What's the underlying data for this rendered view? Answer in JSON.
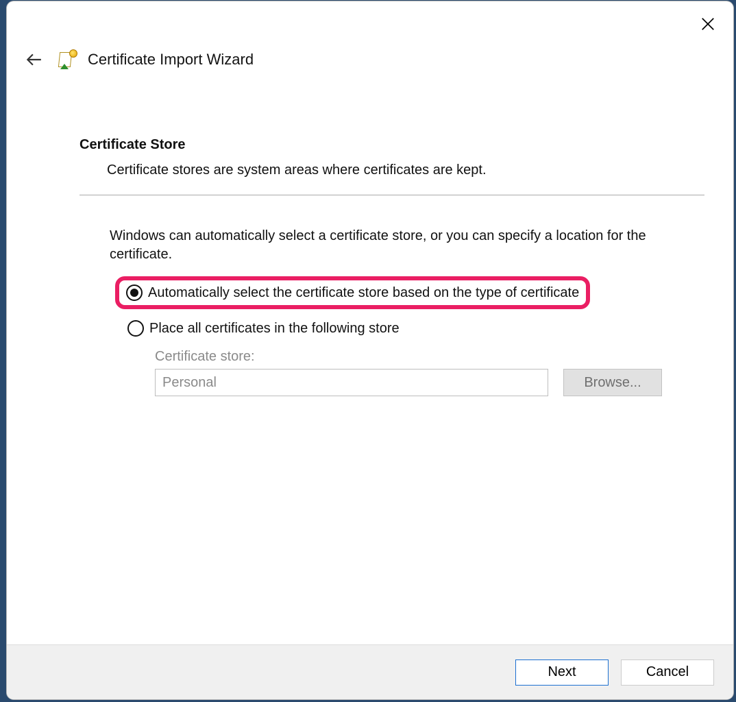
{
  "wizard": {
    "title": "Certificate Import Wizard"
  },
  "section": {
    "heading": "Certificate Store",
    "description": "Certificate stores are system areas where certificates are kept.",
    "instruction": "Windows can automatically select a certificate store, or you can specify a location for the certificate."
  },
  "options": {
    "auto_label": "Automatically select the certificate store based on the type of certificate",
    "place_label": "Place all certificates in the following store",
    "selected": "auto"
  },
  "store": {
    "label": "Certificate store:",
    "value": "Personal",
    "browse_label": "Browse..."
  },
  "footer": {
    "next_label": "Next",
    "cancel_label": "Cancel"
  },
  "colors": {
    "highlight": "#ea1e63",
    "primary_border": "#1b6fd1"
  }
}
